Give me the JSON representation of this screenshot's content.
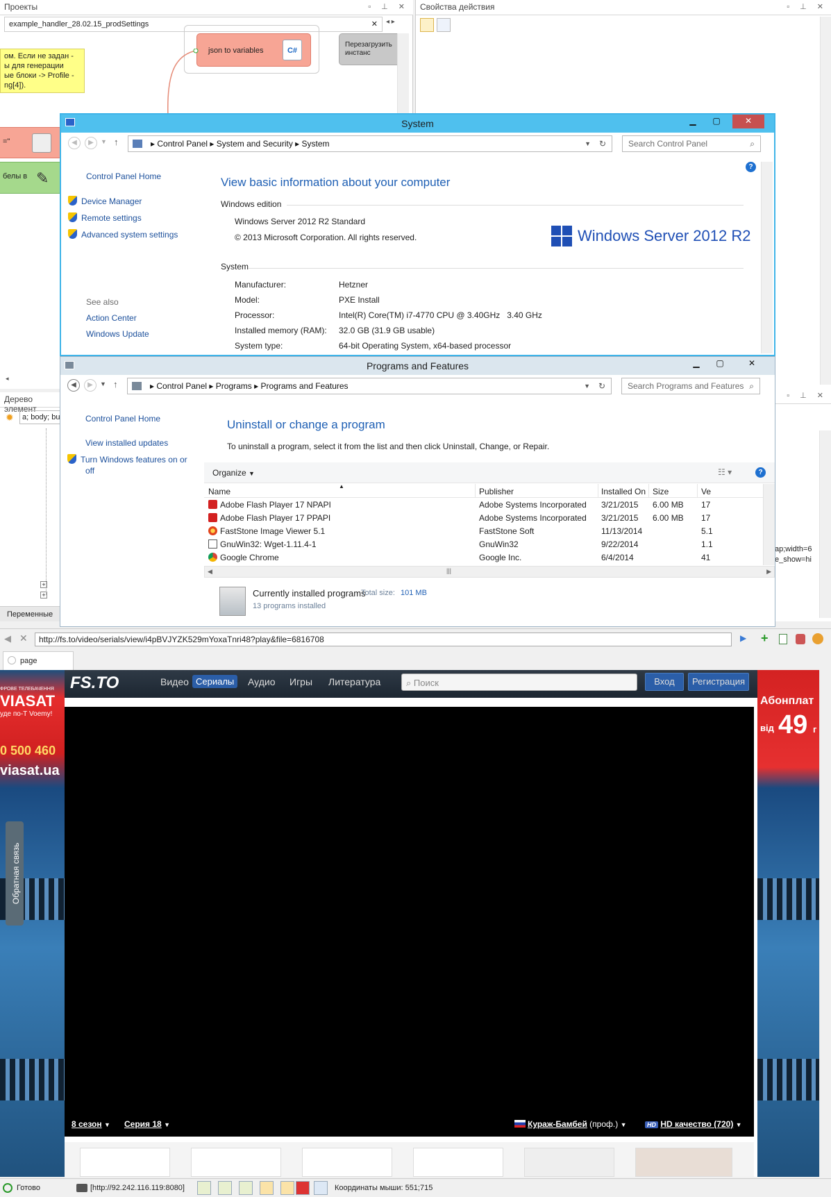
{
  "ide": {
    "projects_panel_title": "Проекты",
    "action_props_title": "Свойства действия",
    "doc_tab": "example_handler_28.02.15_prodSettings",
    "node_json": "json to variables",
    "node_restart": "Перезагрузить инстанс",
    "comment_lines": [
      "ом. Если не задан -",
      "ы для генерации",
      "ые блоки -> Profile -",
      "ng[4])."
    ],
    "side_tag1": "=\"",
    "side_tag2": "белы в",
    "tree_panel_title": "Дерево элемент",
    "tree_input": "a; body; bu",
    "vars_tab": "Переменные",
    "right_frag1": "ap;width=6",
    "right_frag2": "e_show=hi"
  },
  "system_window": {
    "title": "System",
    "breadcrumb": [
      "Control Panel",
      "System and Security",
      "System"
    ],
    "search_placeholder": "Search Control Panel",
    "left_links": {
      "home": "Control Panel Home",
      "device_manager": "Device Manager",
      "remote_settings": "Remote settings",
      "advanced": "Advanced system settings",
      "see_also": "See also",
      "action_center": "Action Center",
      "windows_update": "Windows Update"
    },
    "heading": "View basic information about your computer",
    "edition_label": "Windows edition",
    "edition_name": "Windows Server 2012 R2 Standard",
    "copyright": "© 2013 Microsoft Corporation. All rights reserved.",
    "logo_text": "Windows Server",
    "logo_version": "2012 R2",
    "system_label": "System",
    "rows": [
      {
        "label": "Manufacturer:",
        "value": "Hetzner"
      },
      {
        "label": "Model:",
        "value": "PXE Install"
      },
      {
        "label": "Processor:",
        "value": "Intel(R) Core(TM) i7-4770 CPU @ 3.40GHz   3.40 GHz"
      },
      {
        "label": "Installed memory (RAM):",
        "value": "32.0 GB (31.9 GB usable)"
      },
      {
        "label": "System type:",
        "value": "64-bit Operating System, x64-based processor"
      }
    ]
  },
  "programs_window": {
    "title": "Programs and Features",
    "breadcrumb": [
      "Control Panel",
      "Programs",
      "Programs and Features"
    ],
    "search_placeholder": "Search Programs and Features",
    "left_links": {
      "home": "Control Panel Home",
      "installed_updates": "View installed updates",
      "features_line1": "Turn Windows features on or",
      "features_line2": "off"
    },
    "heading": "Uninstall or change a program",
    "description": "To uninstall a program, select it from the list and then click Uninstall, Change, or Repair.",
    "organize": "Organize",
    "columns": [
      "Name",
      "Publisher",
      "Installed On",
      "Size",
      "Ve"
    ],
    "programs": [
      {
        "name": "Adobe Flash Player 17 NPAPI",
        "publisher": "Adobe Systems Incorporated",
        "installed": "3/21/2015",
        "size": "6.00 MB",
        "ver": "17",
        "icon": "flash-icon"
      },
      {
        "name": "Adobe Flash Player 17 PPAPI",
        "publisher": "Adobe Systems Incorporated",
        "installed": "3/21/2015",
        "size": "6.00 MB",
        "ver": "17",
        "icon": "flash-icon"
      },
      {
        "name": "FastStone Image Viewer 5.1",
        "publisher": "FastStone Soft",
        "installed": "11/13/2014",
        "size": "",
        "ver": "5.1",
        "icon": "faststone-icon"
      },
      {
        "name": "GnuWin32: Wget-1.11.4-1",
        "publisher": "GnuWin32",
        "installed": "9/22/2014",
        "size": "",
        "ver": "1.1",
        "icon": "gnuwin-icon"
      },
      {
        "name": "Google Chrome",
        "publisher": "Google Inc.",
        "installed": "6/4/2014",
        "size": "",
        "ver": "41",
        "icon": "chrome-icon"
      }
    ],
    "footer_title": "Currently installed programs",
    "total_size_label": "Total size:",
    "total_size": "101 MB",
    "count": "13 programs installed"
  },
  "browser": {
    "url": "http://fs.to/video/serials/view/i4pBVJYZK529mYoxaTnri48?play&file=6816708",
    "tab": "page",
    "logo": "FS.TO",
    "nav": [
      "Видео",
      "Сериалы",
      "Аудио",
      "Игры",
      "Литература"
    ],
    "search_placeholder": "Поиск",
    "login": "Вход",
    "register": "Регистрация",
    "season": "8 сезон",
    "episode": "Серия 18",
    "translation": "Кураж-Бамбей",
    "translation_note": "(проф.)",
    "quality_badge": "HD",
    "quality": "HD качество (720)",
    "feedback": "Обратная связь",
    "ad_left": {
      "brand_line": "ФРОВЕ ТЕЛЕБАЧЕННЯ",
      "brand": "VIASAT",
      "tagline": "уде по-Т Voemy!",
      "phone": "0 500 460",
      "site": "viasat.ua"
    },
    "ad_right": {
      "line1": "Абонплат",
      "line2": "від",
      "price": "49",
      "unit": "г"
    }
  },
  "statusbar": {
    "ready": "Готово",
    "proxy": "[http://92.242.116.119:8080]",
    "coords": "Координаты мыши: 551;715"
  }
}
